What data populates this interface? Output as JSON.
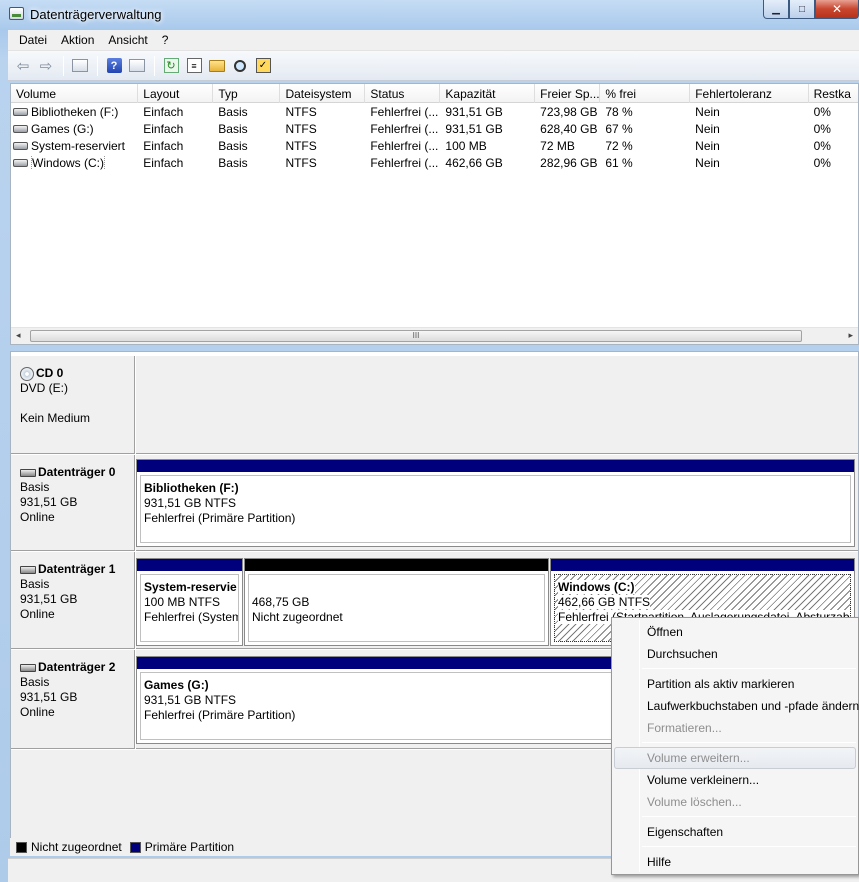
{
  "window": {
    "title": "Datenträgerverwaltung",
    "minimize": "▁",
    "maximize": "□",
    "close": "✕"
  },
  "menu": [
    "Datei",
    "Aktion",
    "Ansicht",
    "?"
  ],
  "toolbar": {
    "back": "⇦",
    "forward": "⇨",
    "help": "?",
    "refresh": "↻",
    "props": "≡",
    "check": "✓"
  },
  "volume_list": {
    "columns": [
      "Volume",
      "Layout",
      "Typ",
      "Dateisystem",
      "Status",
      "Kapazität",
      "Freier Sp...",
      "% frei",
      "Fehlertoleranz",
      "Restka"
    ],
    "rows": [
      [
        "Bibliotheken (F:)",
        "Einfach",
        "Basis",
        "NTFS",
        "Fehlerfrei (...",
        "931,51 GB",
        "723,98 GB",
        "78 %",
        "Nein",
        "0%"
      ],
      [
        "Games (G:)",
        "Einfach",
        "Basis",
        "NTFS",
        "Fehlerfrei (...",
        "931,51 GB",
        "628,40 GB",
        "67 %",
        "Nein",
        "0%"
      ],
      [
        "System-reserviert",
        "Einfach",
        "Basis",
        "NTFS",
        "Fehlerfrei (...",
        "100 MB",
        "72 MB",
        "72 %",
        "Nein",
        "0%"
      ],
      [
        "Windows (C:)",
        "Einfach",
        "Basis",
        "NTFS",
        "Fehlerfrei (...",
        "462,66 GB",
        "282,96 GB",
        "61 %",
        "Nein",
        "0%"
      ]
    ],
    "scroll_left": "◂",
    "scroll_right": "▸",
    "scroll_grip": "III"
  },
  "disks": {
    "cd0": {
      "name": "CD 0",
      "type": "DVD (E:)",
      "status": "Kein Medium"
    },
    "disk0": {
      "name": "Datenträger 0",
      "type": "Basis",
      "size": "931,51 GB",
      "state": "Online",
      "partitions": [
        {
          "title": "Bibliotheken  (F:)",
          "line2": "931,51 GB NTFS",
          "line3": "Fehlerfrei (Primäre Partition)"
        }
      ]
    },
    "disk1": {
      "name": "Datenträger 1",
      "type": "Basis",
      "size": "931,51 GB",
      "state": "Online",
      "partitions": [
        {
          "title": "System-reservie",
          "line2": "100 MB NTFS",
          "line3": "Fehlerfrei (System"
        },
        {
          "title": "",
          "line2": "468,75 GB",
          "line3": "Nicht zugeordnet"
        },
        {
          "title": "Windows  (C:)",
          "line2": "462,66 GB NTFS",
          "line3": "Fehlerfrei (Startpartition, Auslagerungsdatei, Absturzabbild"
        }
      ]
    },
    "disk2": {
      "name": "Datenträger 2",
      "type": "Basis",
      "size": "931,51 GB",
      "state": "Online",
      "partitions": [
        {
          "title": "Games  (G:)",
          "line2": "931,51 GB NTFS",
          "line3": "Fehlerfrei (Primäre Partition)"
        }
      ]
    }
  },
  "legend": [
    {
      "label": "Nicht zugeordnet",
      "color": "#000000"
    },
    {
      "label": "Primäre Partition",
      "color": "#00007c"
    }
  ],
  "context_menu": {
    "items": [
      {
        "label": "Öffnen",
        "enabled": true
      },
      {
        "label": "Durchsuchen",
        "enabled": true
      },
      {
        "label": "Partition als aktiv markieren",
        "enabled": true
      },
      {
        "label": "Laufwerkbuchstaben und -pfade ändern...",
        "enabled": true
      },
      {
        "label": "Formatieren...",
        "enabled": false
      },
      {
        "label": "Volume erweitern...",
        "enabled": false
      },
      {
        "label": "Volume verkleinern...",
        "enabled": true
      },
      {
        "label": "Volume löschen...",
        "enabled": false
      },
      {
        "label": "Eigenschaften",
        "enabled": true
      },
      {
        "label": "Hilfe",
        "enabled": true
      }
    ]
  }
}
